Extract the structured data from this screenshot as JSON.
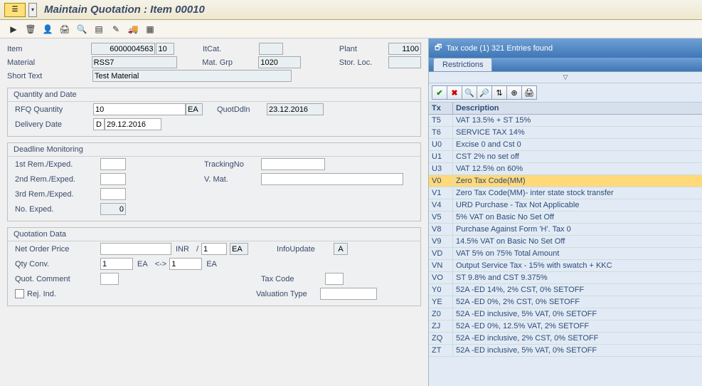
{
  "title": "Maintain Quotation : Item 00010",
  "toolbar_icons": {
    "execute": "▶",
    "delete": "🗑",
    "user": "👤",
    "print": "🖨",
    "find": "🔍",
    "list": "▤",
    "edit": "✎",
    "truck": "🚚",
    "calendar": "▦"
  },
  "header": {
    "item_lbl": "Item",
    "item_val": "6000004563",
    "item_line": "10",
    "itcat_lbl": "ItCat.",
    "itcat_val": "",
    "plant_lbl": "Plant",
    "plant_val": "1100",
    "material_lbl": "Material",
    "material_val": "RSS7",
    "matgrp_lbl": "Mat. Grp",
    "matgrp_val": "1020",
    "storloc_lbl": "Stor. Loc.",
    "storloc_val": "",
    "short_lbl": "Short Text",
    "short_val": "Test Material"
  },
  "qd": {
    "title": "Quantity and Date",
    "rfq_lbl": "RFQ Quantity",
    "rfq_val": "10",
    "rfq_uom": "EA",
    "quotddln_lbl": "QuotDdln",
    "quotddln_val": "23.12.2016",
    "deliv_lbl": "Delivery Date",
    "deliv_cat": "D",
    "deliv_val": "29.12.2016"
  },
  "dm": {
    "title": "Deadline Monitoring",
    "r1_lbl": "1st Rem./Exped.",
    "track_lbl": "TrackingNo",
    "r2_lbl": "2nd Rem./Exped.",
    "vmat_lbl": "V. Mat.",
    "r3_lbl": "3rd Rem./Exped.",
    "no_lbl": "No. Exped.",
    "no_val": "0"
  },
  "qdt": {
    "title": "Quotation Data",
    "netprice_lbl": "Net Order Price",
    "curr": "INR",
    "slash": "/",
    "per": "1",
    "uom": "EA",
    "info_lbl": "InfoUpdate",
    "info_val": "A",
    "qconv_lbl": "Qty Conv.",
    "qc1": "1",
    "qc_uom1": "EA",
    "arrow": "<->",
    "qc2": "1",
    "qc_uom2": "EA",
    "qcomment_lbl": "Quot. Comment",
    "tax_lbl": "Tax Code",
    "rej_lbl": "Rej. Ind.",
    "valtype_lbl": "Valuation Type"
  },
  "popup": {
    "title": "Tax code (1)  321 Entries found",
    "tab": "Restrictions",
    "col_tx": "Tx",
    "col_desc": "Description",
    "selected": "V0",
    "rows": [
      {
        "tx": "T5",
        "desc": "VAT 13.5% + ST 15%"
      },
      {
        "tx": "T6",
        "desc": "SERVICE TAX 14%"
      },
      {
        "tx": "U0",
        "desc": "Excise 0 and Cst 0"
      },
      {
        "tx": "U1",
        "desc": "CST 2% no set off"
      },
      {
        "tx": "U3",
        "desc": "VAT 12.5% on 60%"
      },
      {
        "tx": "V0",
        "desc": "Zero Tax Code(MM)"
      },
      {
        "tx": "V1",
        "desc": "Zero Tax Code(MM)- inter state stock transfer"
      },
      {
        "tx": "V4",
        "desc": "URD Purchase - Tax Not Applicable"
      },
      {
        "tx": "V5",
        "desc": "5% VAT on Basic No Set Off"
      },
      {
        "tx": "V8",
        "desc": "Purchase Against Form 'H'. Tax 0"
      },
      {
        "tx": "V9",
        "desc": "14.5% VAT on Basic  No Set Off"
      },
      {
        "tx": "VD",
        "desc": "VAT 5% on 75% Total Amount"
      },
      {
        "tx": "VN",
        "desc": "Output Service Tax - 15% with swatch + KKC"
      },
      {
        "tx": "VO",
        "desc": "ST 9.8% and CST 9.375%"
      },
      {
        "tx": "Y0",
        "desc": "52A -ED 14%, 2% CST, 0% SETOFF"
      },
      {
        "tx": "YE",
        "desc": "52A -ED 0%, 2% CST, 0% SETOFF"
      },
      {
        "tx": "Z0",
        "desc": "52A -ED inclusive, 5% VAT, 0% SETOFF"
      },
      {
        "tx": "ZJ",
        "desc": "52A -ED 0%, 12.5% VAT, 2% SETOFF"
      },
      {
        "tx": "ZQ",
        "desc": "52A -ED inclusive, 2% CST, 0% SETOFF"
      },
      {
        "tx": "ZT",
        "desc": "52A -ED inclusive, 5% VAT, 0% SETOFF"
      }
    ]
  }
}
